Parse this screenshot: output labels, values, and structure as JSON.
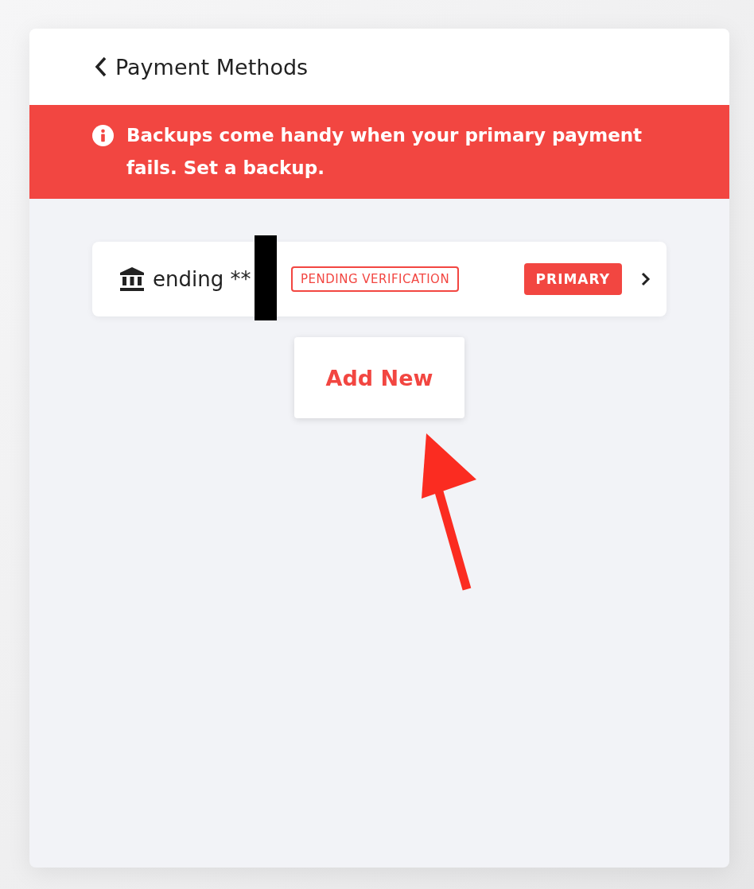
{
  "header": {
    "title": "Payment Methods"
  },
  "alert": {
    "message": "Backups come handy when your primary payment fails. Set a backup."
  },
  "payment_methods": [
    {
      "label": "ending **",
      "status": "PENDING VERIFICATION",
      "primary": true,
      "primary_label": "PRIMARY",
      "redacted": true
    }
  ],
  "add_button": {
    "label": "Add New"
  },
  "annotation": {
    "kind": "arrow"
  }
}
